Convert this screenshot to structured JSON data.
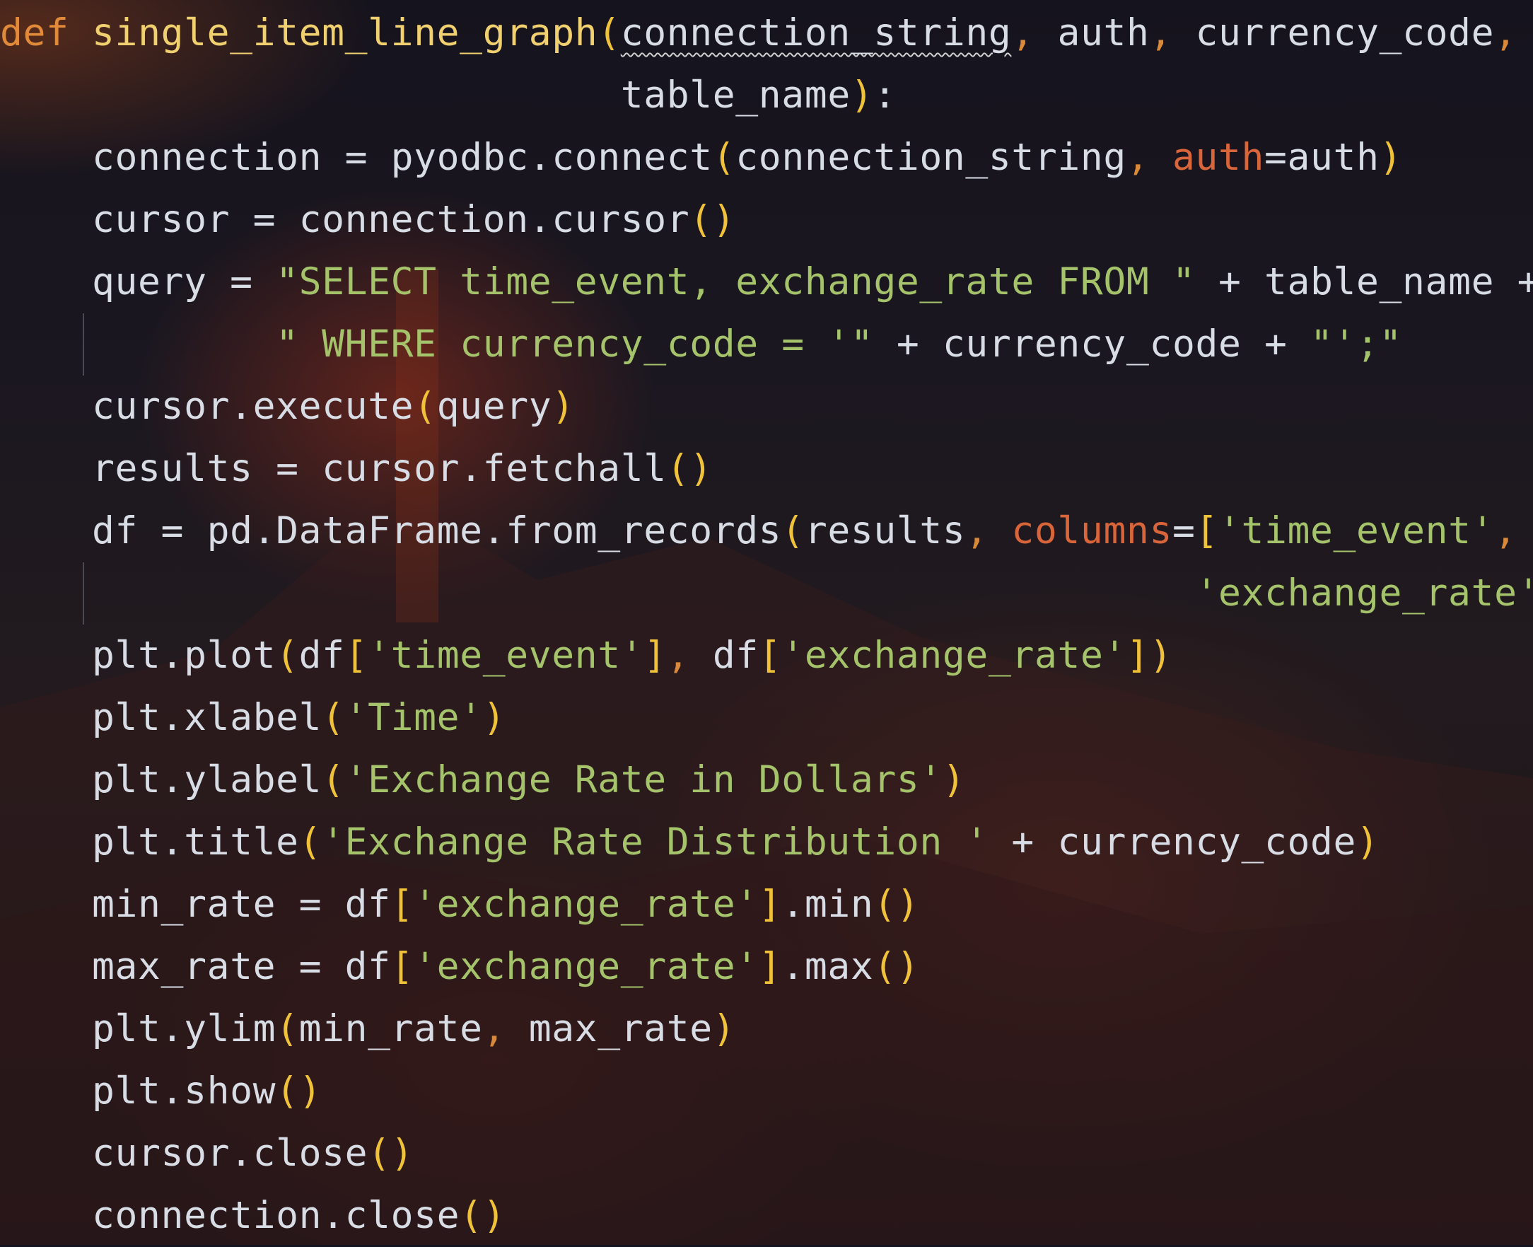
{
  "editor": {
    "language": "python",
    "theme": {
      "background": "#141320",
      "keyword": "#e08a3a",
      "function_name": "#f1d06f",
      "identifier": "#d8dce4",
      "bracket": "#f0c23a",
      "keyword_argument": "#d9653a",
      "string": "#a4c36a"
    },
    "lines": [
      {
        "tokens": [
          {
            "t": "def",
            "c": "kw"
          },
          {
            "t": " ",
            "c": "op"
          },
          {
            "t": "single_item_line_graph",
            "c": "fn"
          },
          {
            "t": "(",
            "c": "paren"
          },
          {
            "t": "connection_string",
            "c": "param",
            "squiggle": true
          },
          {
            "t": ",",
            "c": "comma"
          },
          {
            "t": " auth",
            "c": "param"
          },
          {
            "t": ",",
            "c": "comma"
          },
          {
            "t": " currency_code",
            "c": "param"
          },
          {
            "t": ",",
            "c": "comma"
          }
        ]
      },
      {
        "tokens": [
          {
            "t": "                           table_name",
            "c": "param"
          },
          {
            "t": ")",
            "c": "paren"
          },
          {
            "t": ":",
            "c": "op"
          }
        ]
      },
      {
        "tokens": [
          {
            "t": "    connection = pyodbc.connect",
            "c": "ident"
          },
          {
            "t": "(",
            "c": "paren"
          },
          {
            "t": "connection_string",
            "c": "ident"
          },
          {
            "t": ",",
            "c": "comma"
          },
          {
            "t": " ",
            "c": "op"
          },
          {
            "t": "auth",
            "c": "kwarg"
          },
          {
            "t": "=auth",
            "c": "ident"
          },
          {
            "t": ")",
            "c": "paren"
          }
        ]
      },
      {
        "tokens": [
          {
            "t": "    cursor = connection.cursor",
            "c": "ident"
          },
          {
            "t": "()",
            "c": "paren"
          }
        ]
      },
      {
        "tokens": [
          {
            "t": "    query = ",
            "c": "ident"
          },
          {
            "t": "\"SELECT time_event, exchange_rate FROM \"",
            "c": "str"
          },
          {
            "t": " + table_name + \\",
            "c": "ident"
          }
        ]
      },
      {
        "guide": true,
        "tokens": [
          {
            "t": "            ",
            "c": "op"
          },
          {
            "t": "\" WHERE currency_code = '\"",
            "c": "str"
          },
          {
            "t": " + currency_code + ",
            "c": "ident"
          },
          {
            "t": "\"';\"",
            "c": "str"
          }
        ]
      },
      {
        "tokens": [
          {
            "t": "    cursor.execute",
            "c": "ident"
          },
          {
            "t": "(",
            "c": "paren"
          },
          {
            "t": "query",
            "c": "ident"
          },
          {
            "t": ")",
            "c": "paren"
          }
        ]
      },
      {
        "tokens": [
          {
            "t": "    results = cursor.fetchall",
            "c": "ident"
          },
          {
            "t": "()",
            "c": "paren"
          }
        ]
      },
      {
        "tokens": [
          {
            "t": "    df = pd.DataFrame.from_records",
            "c": "ident"
          },
          {
            "t": "(",
            "c": "paren"
          },
          {
            "t": "results",
            "c": "ident"
          },
          {
            "t": ",",
            "c": "comma"
          },
          {
            "t": " ",
            "c": "op"
          },
          {
            "t": "columns",
            "c": "kwarg"
          },
          {
            "t": "=",
            "c": "ident"
          },
          {
            "t": "[",
            "c": "paren"
          },
          {
            "t": "'time_event'",
            "c": "str"
          },
          {
            "t": ",",
            "c": "comma"
          }
        ]
      },
      {
        "guide": true,
        "tokens": [
          {
            "t": "                                                    ",
            "c": "op"
          },
          {
            "t": "'exchange_rate'",
            "c": "str"
          },
          {
            "t": "])",
            "c": "paren"
          }
        ]
      },
      {
        "tokens": [
          {
            "t": "    plt.plot",
            "c": "ident"
          },
          {
            "t": "(",
            "c": "paren"
          },
          {
            "t": "df",
            "c": "ident"
          },
          {
            "t": "[",
            "c": "paren"
          },
          {
            "t": "'time_event'",
            "c": "str"
          },
          {
            "t": "]",
            "c": "paren"
          },
          {
            "t": ",",
            "c": "comma"
          },
          {
            "t": " df",
            "c": "ident"
          },
          {
            "t": "[",
            "c": "paren"
          },
          {
            "t": "'exchange_rate'",
            "c": "str"
          },
          {
            "t": "])",
            "c": "paren"
          }
        ]
      },
      {
        "tokens": [
          {
            "t": "    plt.xlabel",
            "c": "ident"
          },
          {
            "t": "(",
            "c": "paren"
          },
          {
            "t": "'Time'",
            "c": "str"
          },
          {
            "t": ")",
            "c": "paren"
          }
        ]
      },
      {
        "tokens": [
          {
            "t": "    plt.ylabel",
            "c": "ident"
          },
          {
            "t": "(",
            "c": "paren"
          },
          {
            "t": "'Exchange Rate in Dollars'",
            "c": "str"
          },
          {
            "t": ")",
            "c": "paren"
          }
        ]
      },
      {
        "tokens": [
          {
            "t": "    plt.title",
            "c": "ident"
          },
          {
            "t": "(",
            "c": "paren"
          },
          {
            "t": "'Exchange Rate Distribution '",
            "c": "str"
          },
          {
            "t": " + currency_code",
            "c": "ident"
          },
          {
            "t": ")",
            "c": "paren"
          }
        ]
      },
      {
        "tokens": [
          {
            "t": "    min_rate = df",
            "c": "ident"
          },
          {
            "t": "[",
            "c": "paren"
          },
          {
            "t": "'exchange_rate'",
            "c": "str"
          },
          {
            "t": "]",
            "c": "paren"
          },
          {
            "t": ".min",
            "c": "ident"
          },
          {
            "t": "()",
            "c": "paren"
          }
        ]
      },
      {
        "tokens": [
          {
            "t": "    max_rate = df",
            "c": "ident"
          },
          {
            "t": "[",
            "c": "paren"
          },
          {
            "t": "'exchange_rate'",
            "c": "str"
          },
          {
            "t": "]",
            "c": "paren"
          },
          {
            "t": ".max",
            "c": "ident"
          },
          {
            "t": "()",
            "c": "paren"
          }
        ]
      },
      {
        "tokens": [
          {
            "t": "    plt.ylim",
            "c": "ident"
          },
          {
            "t": "(",
            "c": "paren"
          },
          {
            "t": "min_rate",
            "c": "ident"
          },
          {
            "t": ",",
            "c": "comma"
          },
          {
            "t": " max_rate",
            "c": "ident"
          },
          {
            "t": ")",
            "c": "paren"
          }
        ]
      },
      {
        "tokens": [
          {
            "t": "    plt.show",
            "c": "ident"
          },
          {
            "t": "()",
            "c": "paren"
          }
        ]
      },
      {
        "tokens": [
          {
            "t": "    cursor.close",
            "c": "ident"
          },
          {
            "t": "()",
            "c": "paren"
          }
        ]
      },
      {
        "tokens": [
          {
            "t": "    connection.close",
            "c": "ident"
          },
          {
            "t": "()",
            "c": "paren"
          }
        ]
      }
    ]
  }
}
